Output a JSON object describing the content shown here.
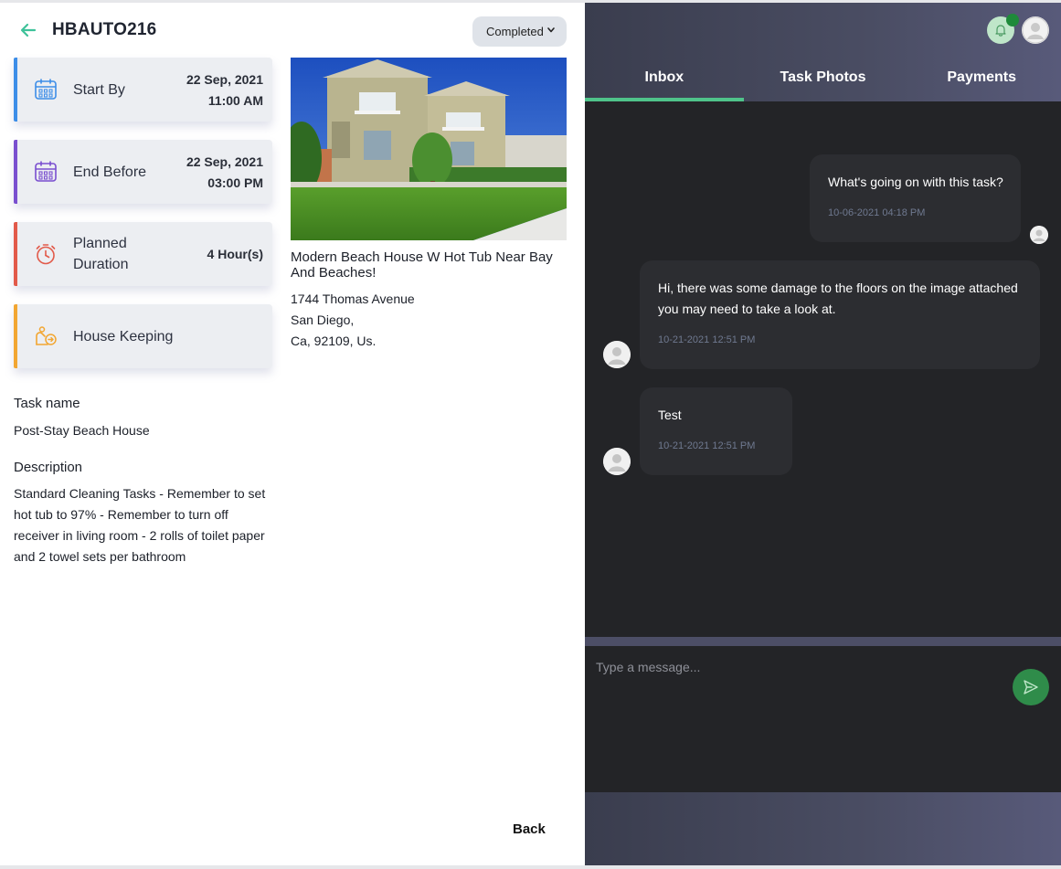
{
  "task": {
    "code": "HBAUTO216",
    "status": "Completed"
  },
  "cards": [
    {
      "label": "Start By",
      "value_line1": "22 Sep, 2021",
      "value_line2": "11:00 AM",
      "accent": "#3d8ee8",
      "icon": "calendar-icon"
    },
    {
      "label": "End Before",
      "value_line1": "22 Sep, 2021",
      "value_line2": "03:00 PM",
      "accent": "#7a4fcf",
      "icon": "calendar-icon"
    },
    {
      "label_line1": "Planned",
      "label_line2": "Duration",
      "value": "4 Hour(s)",
      "accent": "#e25a4a",
      "icon": "stopwatch-icon"
    },
    {
      "label": "House Keeping",
      "accent": "#f2a632",
      "icon": "housekeeping-icon"
    }
  ],
  "property": {
    "title": "Modern Beach House W Hot Tub Near Bay And Beaches!",
    "address_line1": "1744 Thomas Avenue",
    "address_line2": "San Diego,",
    "address_line3": "Ca, 92109, Us."
  },
  "details": {
    "task_name_label": "Task name",
    "task_name_value": "Post-Stay Beach House",
    "description_label": "Description",
    "description_value": "Standard Cleaning Tasks - Remember to set hot tub to 97% - Remember to turn off receiver in living room - 2 rolls of toilet paper and 2 towel sets per bathroom"
  },
  "footer": {
    "back_label": "Back"
  },
  "tabs": [
    {
      "label": "Inbox",
      "active": true
    },
    {
      "label": "Task Photos",
      "active": false
    },
    {
      "label": "Payments",
      "active": false
    }
  ],
  "messages": [
    {
      "text": "What's going on with this task?",
      "time": "10-06-2021 04:18 PM",
      "side": "right"
    },
    {
      "text": "Hi, there was some damage to the floors on the image attached you may need to take a look at.",
      "time": "10-21-2021 12:51 PM",
      "side": "left"
    },
    {
      "text": "Test",
      "time": "10-21-2021 12:51 PM",
      "side": "left"
    }
  ],
  "composer": {
    "placeholder": "Type a message..."
  },
  "colors": {
    "accent_green": "#4fc38a",
    "send_button": "#2f8c4a",
    "chat_bg": "#232427",
    "bubble_bg": "#2c2d31"
  }
}
